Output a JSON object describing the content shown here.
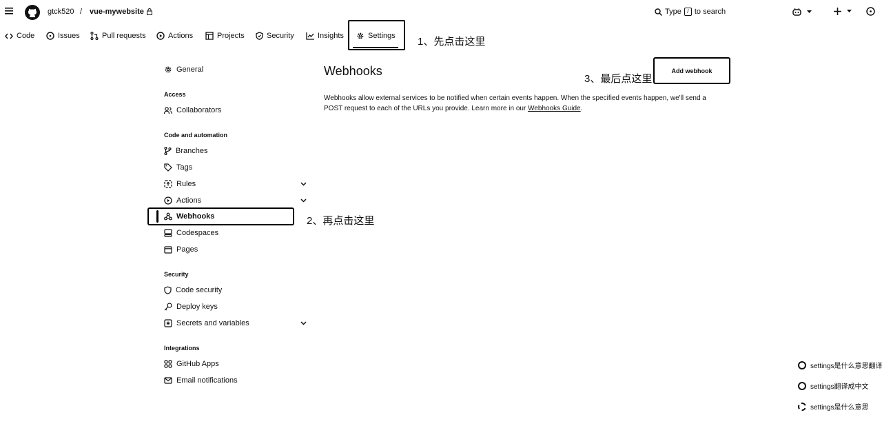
{
  "header": {
    "owner": "gtck520",
    "separator": "/",
    "repo": "vue-mywebsite",
    "search_prefix": "Type",
    "search_key": "/",
    "search_suffix": "to search"
  },
  "tabs": [
    {
      "label": "Code",
      "icon": "code-icon"
    },
    {
      "label": "Issues",
      "icon": "issue-icon"
    },
    {
      "label": "Pull requests",
      "icon": "pull-request-icon"
    },
    {
      "label": "Actions",
      "icon": "play-icon"
    },
    {
      "label": "Projects",
      "icon": "table-icon"
    },
    {
      "label": "Security",
      "icon": "shield-icon"
    },
    {
      "label": "Insights",
      "icon": "graph-icon"
    },
    {
      "label": "Settings",
      "icon": "gear-icon"
    }
  ],
  "annotations": {
    "step1": "1、先点击这里",
    "step2": "2、再点击这里",
    "step3": "3、最后点这里"
  },
  "sidebar": {
    "general": "General",
    "access_heading": "Access",
    "collaborators": "Collaborators",
    "code_heading": "Code and automation",
    "branches": "Branches",
    "tags": "Tags",
    "rules": "Rules",
    "actions": "Actions",
    "webhooks": "Webhooks",
    "codespaces": "Codespaces",
    "pages": "Pages",
    "security_heading": "Security",
    "code_security": "Code security",
    "deploy_keys": "Deploy keys",
    "secrets": "Secrets and variables",
    "integrations_heading": "Integrations",
    "github_apps": "GitHub Apps",
    "email_notifications": "Email notifications"
  },
  "main": {
    "title": "Webhooks",
    "add_button": "Add webhook",
    "desc_text": "Webhooks allow external services to be notified when certain events happen. When the specified events happen, we'll send a POST request to each of the URLs you provide. Learn more in our ",
    "desc_link": "Webhooks Guide",
    "desc_end": "."
  },
  "suggestions": [
    "settings是什么意思翻译",
    "settings翻译成中文",
    "settings是什么意思"
  ]
}
